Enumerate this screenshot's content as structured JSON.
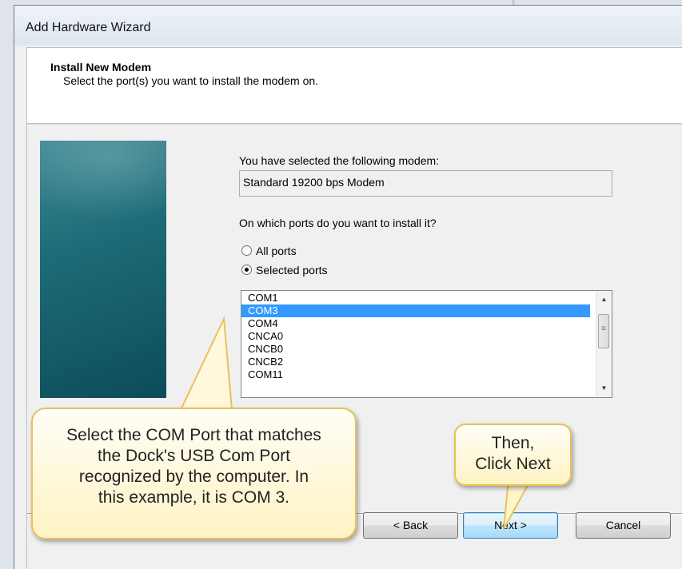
{
  "window": {
    "title": "Add Hardware Wizard"
  },
  "header": {
    "title": "Install New Modem",
    "subtitle": "Select the port(s) you want to install the modem on."
  },
  "modem": {
    "label": "You have selected the following modem:",
    "value": "Standard 19200 bps Modem"
  },
  "ports": {
    "question": "On which ports do you want to install it?",
    "options": [
      {
        "label": "All ports",
        "selected": false
      },
      {
        "label": "Selected ports",
        "selected": true
      }
    ],
    "list": [
      "COM1",
      "COM3",
      "COM4",
      "CNCA0",
      "CNCB0",
      "CNCB2",
      "COM11"
    ],
    "selected_index": 1
  },
  "buttons": {
    "back": "< Back",
    "next": "Next >",
    "cancel": "Cancel"
  },
  "callouts": {
    "left": "Select the COM Port that matches the Dock's USB Com Port recognized by the computer.  In this example, it is COM 3.",
    "right_line1": "Then,",
    "right_line2": "Click Next"
  },
  "colors": {
    "selection": "#3399ff",
    "callout_border": "#e8c15a",
    "sidebar": "#1d6b78"
  }
}
